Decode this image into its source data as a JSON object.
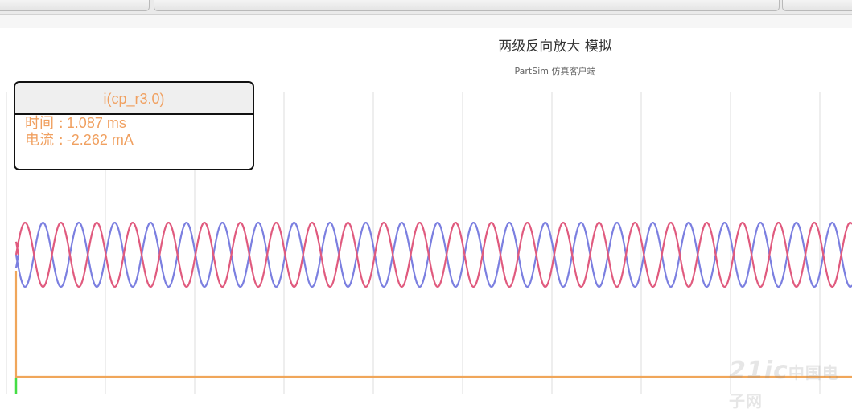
{
  "chart_data": {
    "type": "line",
    "title": "两级反向放大 模拟",
    "subtitle": "PartSim 仿真客户端",
    "xlabel": "",
    "ylabel": "",
    "grid": true,
    "legend": "none",
    "series": [
      {
        "color": "#7b7fe0",
        "kind": "sine",
        "offset": 0.0,
        "amplitude": 1.0,
        "cycles": 23.3,
        "phase_deg": 180,
        "start_value": -0.45
      },
      {
        "color": "#e05a7e",
        "kind": "sine",
        "offset": 0.0,
        "amplitude": 1.0,
        "cycles": 23.3,
        "phase_deg": 0,
        "start_value": 0.45
      },
      {
        "color": "#f0a65a",
        "kind": "flat",
        "value": -2.262
      },
      {
        "color": "#44dd44",
        "kind": "marker"
      }
    ]
  },
  "tooltip": {
    "series_name": "i(cp_r3.0)",
    "time_label": "时间 :",
    "time_value": "1.087 ms",
    "current_label": "电流 :",
    "current_value": "-2.262 mA"
  },
  "watermark": {
    "text": "21ic",
    "cn_text": "中国电子网"
  },
  "colors": {
    "tooltip_text": "#f0a060",
    "grid": "#dcdcdc"
  }
}
